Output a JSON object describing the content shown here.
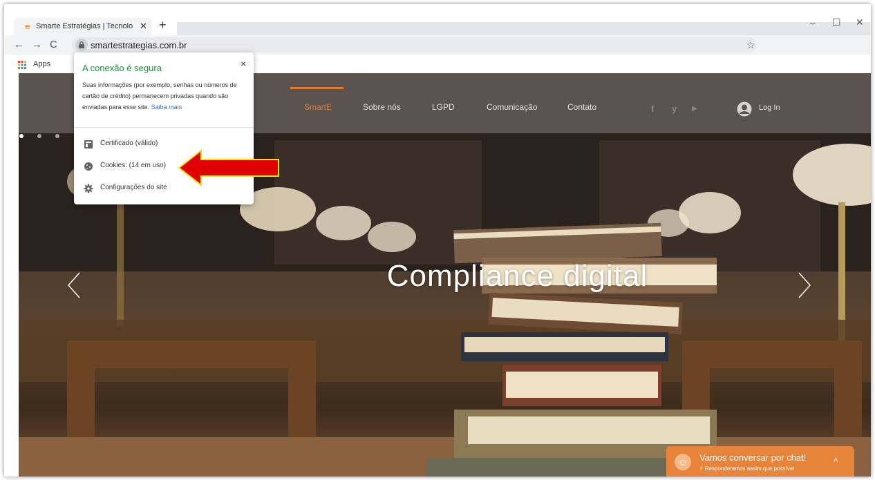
{
  "browser": {
    "tab_title": "Smarte Estratégias | Tecnologia |",
    "tab_close": "✕",
    "new_tab": "+",
    "url": "smartestrategias.com.br",
    "bookmarks_apps": "Apps",
    "window_controls": [
      "–",
      "☐",
      "✕"
    ],
    "nav_back": "←",
    "nav_forward": "→",
    "nav_reload": "C",
    "star": "☆"
  },
  "site_info_popup": {
    "title": "A conexão é segura",
    "close": "×",
    "description": "Suas informações (por exemplo, senhas ou números de cartão de crédito) permanecem privadas quando são enviadas para esse site.",
    "link": "Saiba mais",
    "items": [
      {
        "icon": "certificate-icon",
        "label": "Certificado (válido)"
      },
      {
        "icon": "cookie-icon",
        "label": "Cookies: (14 em uso)"
      },
      {
        "icon": "gear-icon",
        "label": "Configurações do site"
      }
    ]
  },
  "site": {
    "nav": {
      "items": [
        "SmartE",
        "Sobre nós",
        "LGPD",
        "Comunicação",
        "Contato"
      ],
      "active_index": 0,
      "social_icons": [
        "facebook-icon",
        "twitter-icon",
        "youtube-icon"
      ],
      "social_glyphs": [
        "f",
        "y",
        "▶"
      ],
      "login": "Log In"
    },
    "hero": {
      "title": "Compliance digital",
      "prev": "‹",
      "next": "›"
    },
    "chat": {
      "title": "Vamos conversar por chat!",
      "subtitle": "Responderemos assim que possível",
      "chevron": "^"
    }
  },
  "colors": {
    "accent": "#e07b2f",
    "nav_bg": "#5b5350",
    "secure_green": "#1e8e3e",
    "link_blue": "#1a73e8",
    "annotation_arrow": "#e00000"
  }
}
